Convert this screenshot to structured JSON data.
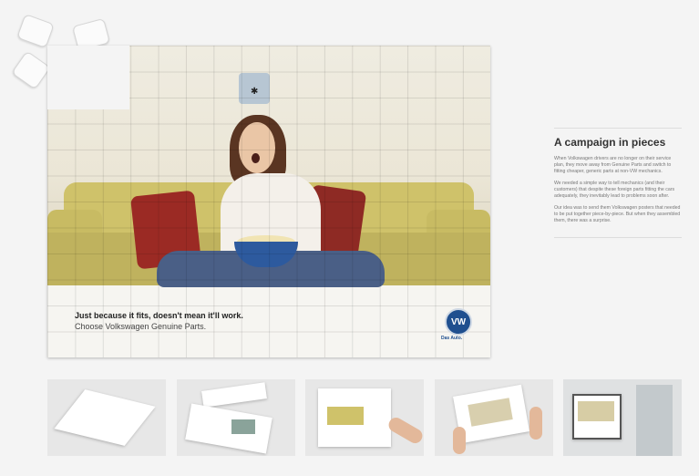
{
  "campaign": {
    "title": "A campaign in pieces",
    "paragraphs": [
      "When Volkswagen drivers are no longer on their service plan, they move away from Genuine Parts and switch to fitting cheaper, generic parts at non-VW mechanics.",
      "We needed a simple way to tell mechanics (and their customers) that despite these foreign parts fitting the cars adequately, they inevitably lead to problems soon after.",
      "Our idea was to send them Volkswagen posters that needed to be put together piece-by-piece. But when they assembled them, there was a surprise."
    ]
  },
  "poster": {
    "tagline_line1": "Just because it fits, doesn't mean it'll work.",
    "tagline_line2": "Choose Volkswagen Genuine Parts.",
    "logo_text": "VW",
    "logo_sub": "Das Auto."
  },
  "thumbnails": [
    {
      "name": "closed-box"
    },
    {
      "name": "open-box-pieces"
    },
    {
      "name": "assembling-puzzle"
    },
    {
      "name": "framing-poster"
    },
    {
      "name": "framed-poster-on-wall"
    }
  ],
  "colors": {
    "vw_blue": "#1f4f8f",
    "sofa": "#cfc26a",
    "pillow": "#9b2a24"
  }
}
